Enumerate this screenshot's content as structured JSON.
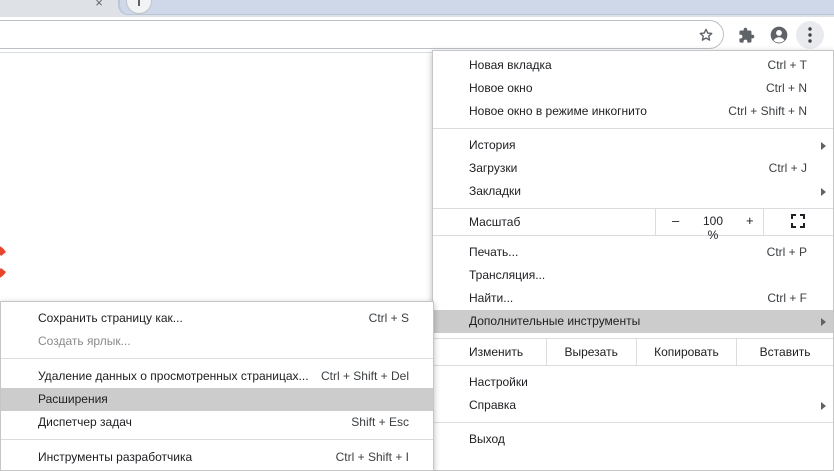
{
  "main_menu": {
    "new_tab": {
      "label": "Новая вкладка",
      "shortcut": "Ctrl + T"
    },
    "new_window": {
      "label": "Новое окно",
      "shortcut": "Ctrl + N"
    },
    "incognito": {
      "label": "Новое окно в режиме инкогнито",
      "shortcut": "Ctrl + Shift + N"
    },
    "history": {
      "label": "История"
    },
    "downloads": {
      "label": "Загрузки",
      "shortcut": "Ctrl + J"
    },
    "bookmarks": {
      "label": "Закладки"
    },
    "zoom": {
      "label": "Масштаб",
      "minus": "–",
      "value": "100 %",
      "plus": "+"
    },
    "print": {
      "label": "Печать...",
      "shortcut": "Ctrl + P"
    },
    "cast": {
      "label": "Трансляция..."
    },
    "find": {
      "label": "Найти...",
      "shortcut": "Ctrl + F"
    },
    "more_tools": {
      "label": "Дополнительные инструменты"
    },
    "edit": {
      "label": "Изменить",
      "cut": "Вырезать",
      "copy": "Копировать",
      "paste": "Вставить"
    },
    "settings": {
      "label": "Настройки"
    },
    "help": {
      "label": "Справка"
    },
    "exit": {
      "label": "Выход"
    }
  },
  "sub_menu": {
    "save_page": {
      "label": "Сохранить страницу как...",
      "shortcut": "Ctrl + S"
    },
    "create_shortcut": {
      "label": "Создать ярлык..."
    },
    "clear_data": {
      "label": "Удаление данных о просмотренных страницах...",
      "shortcut": "Ctrl + Shift + Del"
    },
    "extensions": {
      "label": "Расширения"
    },
    "task_manager": {
      "label": "Диспетчер задач",
      "shortcut": "Shift + Esc"
    },
    "dev_tools": {
      "label": "Инструменты разработчика",
      "shortcut": "Ctrl + Shift + I"
    }
  },
  "toolbar": {
    "icons": [
      "star-icon",
      "extensions-puzzle-icon",
      "profile-icon",
      "menu-dots-icon"
    ],
    "tab_close": "×"
  },
  "colors": {
    "highlight": "#cccccc",
    "separator": "#dadce0",
    "page_accent": "#e8452c"
  }
}
